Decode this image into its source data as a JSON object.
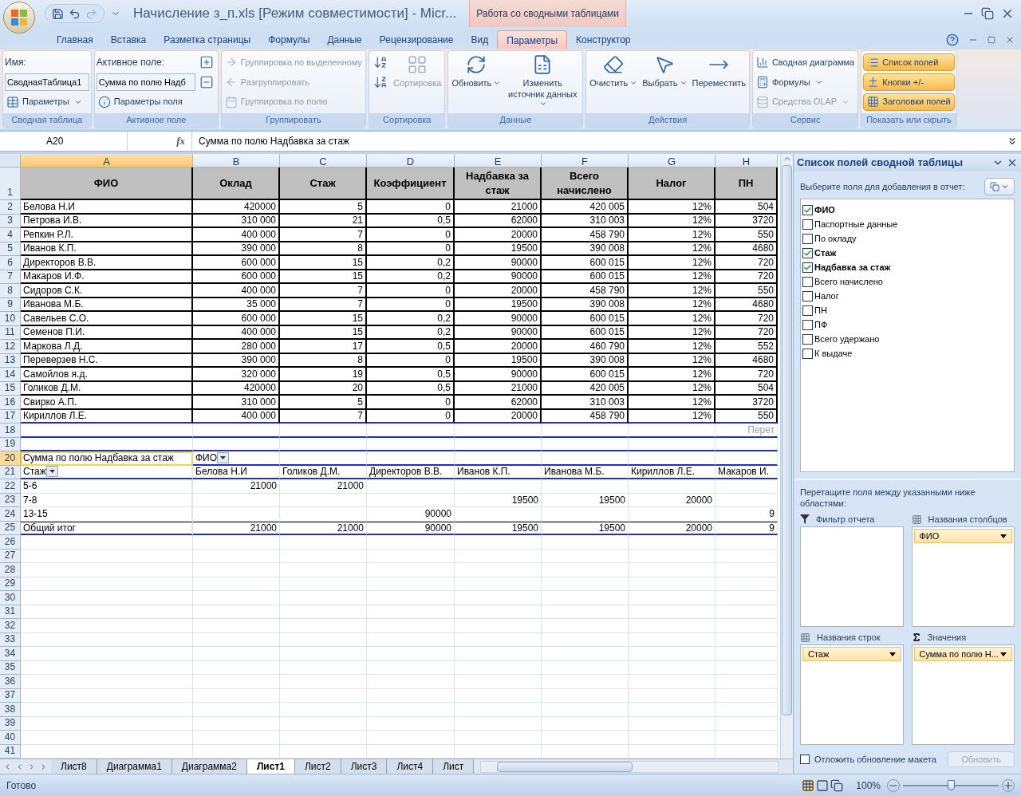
{
  "title_bar": {
    "title": "Начисление з_п.xls  [Режим совместимости] - Micr...",
    "context_tab": "Работа со сводными таблицами"
  },
  "ribbon_tabs": [
    {
      "label": "Главная",
      "selected": false
    },
    {
      "label": "Вставка",
      "selected": false
    },
    {
      "label": "Разметка страницы",
      "selected": false
    },
    {
      "label": "Формулы",
      "selected": false
    },
    {
      "label": "Данные",
      "selected": false
    },
    {
      "label": "Рецензирование",
      "selected": false
    },
    {
      "label": "Вид",
      "selected": false
    },
    {
      "label": "Параметры",
      "selected": true
    },
    {
      "label": "Конструктор",
      "selected": false
    }
  ],
  "ribbon_groups": [
    {
      "label": "Сводная таблица",
      "items": [
        {
          "kind": "caption",
          "label": "Имя:"
        },
        {
          "kind": "field",
          "value": "СводнаяТаблица1"
        },
        {
          "kind": "small",
          "label": "Параметры",
          "dropdown": true,
          "disabled": false
        }
      ]
    },
    {
      "label": "Активное поле",
      "items": [
        {
          "kind": "caption",
          "label": "Активное поле:"
        },
        {
          "kind": "field",
          "value": "Сумма по полю Надб"
        },
        {
          "kind": "small",
          "label": "Параметры поля",
          "disabled": false
        },
        {
          "kind": "icon",
          "disabled": false
        },
        {
          "kind": "icon",
          "disabled": false
        }
      ]
    },
    {
      "label": "Группировать",
      "items": [
        {
          "kind": "small",
          "label": "Группировка по выделенному",
          "disabled": true
        },
        {
          "kind": "small",
          "label": "Разгруппировать",
          "disabled": true
        },
        {
          "kind": "small",
          "label": "Группировка по полю",
          "disabled": true
        }
      ]
    },
    {
      "label": "Сортировка",
      "items": [
        {
          "kind": "icon",
          "disabled": false
        },
        {
          "kind": "icon",
          "disabled": false
        },
        {
          "kind": "large",
          "label": "Сортировка",
          "disabled": true
        }
      ]
    },
    {
      "label": "Данные",
      "items": [
        {
          "kind": "large",
          "label": "Обновить",
          "dropdown": true,
          "disabled": false
        },
        {
          "kind": "large",
          "label": "Изменить источник данных",
          "dropdown": true,
          "disabled": false
        }
      ]
    },
    {
      "label": "Действия",
      "items": [
        {
          "kind": "large",
          "label": "Очистить",
          "dropdown": true,
          "disabled": false
        },
        {
          "kind": "large",
          "label": "Выбрать",
          "dropdown": true,
          "disabled": false
        },
        {
          "kind": "large",
          "label": "Переместить",
          "disabled": false
        }
      ]
    },
    {
      "label": "Сервис",
      "items": [
        {
          "kind": "small",
          "label": "Сводная диаграмма",
          "disabled": false
        },
        {
          "kind": "small",
          "label": "Формулы",
          "dropdown": true,
          "disabled": false
        },
        {
          "kind": "small",
          "label": "Средства OLAP",
          "dropdown": true,
          "disabled": true
        }
      ]
    },
    {
      "label": "Показать или скрыть",
      "items": [
        {
          "kind": "toggle",
          "label": "Список полей",
          "on": true
        },
        {
          "kind": "toggle",
          "label": "Кнопки +/-",
          "on": true
        },
        {
          "kind": "toggle",
          "label": "Заголовки полей",
          "on": true
        }
      ]
    }
  ],
  "formula_bar": {
    "name_box": "A20",
    "function_label": "fx",
    "formula": "Сумма по полю Надбавка за стаж"
  },
  "sheet": {
    "columns": [
      {
        "letter": "A",
        "selected": true
      },
      {
        "letter": "B",
        "selected": false
      },
      {
        "letter": "C",
        "selected": false
      },
      {
        "letter": "D",
        "selected": false
      },
      {
        "letter": "E",
        "selected": false
      },
      {
        "letter": "F",
        "selected": false
      },
      {
        "letter": "G",
        "selected": false
      },
      {
        "letter": "H",
        "selected": false
      }
    ],
    "rows": [
      {
        "number": "1",
        "selected": false,
        "kind": "header",
        "cells": [
          "ФИО",
          "Оклад",
          "Стаж",
          "Коэффициент",
          "Надбавка за стаж",
          "Всего начислено",
          "Налог",
          "ПН"
        ]
      },
      {
        "number": "2",
        "selected": false,
        "kind": "data",
        "cells": [
          "Белова Н.И",
          "420000",
          "5",
          "0",
          "21000",
          "420 005",
          "12%",
          "504"
        ]
      },
      {
        "number": "3",
        "selected": false,
        "kind": "data",
        "cells": [
          "Петрова И.В.",
          "310 000",
          "21",
          "0,5",
          "62000",
          "310 003",
          "12%",
          "3720"
        ]
      },
      {
        "number": "4",
        "selected": false,
        "kind": "data",
        "cells": [
          "Репкин Р.Л.",
          "400 000",
          "7",
          "0",
          "20000",
          "458 790",
          "12%",
          "550"
        ]
      },
      {
        "number": "5",
        "selected": false,
        "kind": "data",
        "cells": [
          "Иванов К.П.",
          "390 000",
          "8",
          "0",
          "19500",
          "390 008",
          "12%",
          "4680"
        ]
      },
      {
        "number": "6",
        "selected": false,
        "kind": "data",
        "cells": [
          "Директоров В.В.",
          "600 000",
          "15",
          "0,2",
          "90000",
          "600 015",
          "12%",
          "720"
        ]
      },
      {
        "number": "7",
        "selected": false,
        "kind": "data",
        "cells": [
          "Макаров И.Ф.",
          "600 000",
          "15",
          "0,2",
          "90000",
          "600 015",
          "12%",
          "720"
        ]
      },
      {
        "number": "8",
        "selected": false,
        "kind": "data",
        "cells": [
          "Сидоров С.К.",
          "400 000",
          "7",
          "0",
          "20000",
          "458 790",
          "12%",
          "550"
        ]
      },
      {
        "number": "9",
        "selected": false,
        "kind": "data",
        "cells": [
          "Иванова М.Б.",
          "35 000",
          "7",
          "0",
          "19500",
          "390 008",
          "12%",
          "4680"
        ]
      },
      {
        "number": "10",
        "selected": false,
        "kind": "data",
        "cells": [
          "Савельев С.О.",
          "600 000",
          "15",
          "0,2",
          "90000",
          "600 015",
          "12%",
          "720"
        ]
      },
      {
        "number": "11",
        "selected": false,
        "kind": "data",
        "cells": [
          "Семенов П.И.",
          "400 000",
          "15",
          "0,2",
          "90000",
          "600 015",
          "12%",
          "720"
        ]
      },
      {
        "number": "12",
        "selected": false,
        "kind": "data",
        "cells": [
          "Маркова Л.Д.",
          "280 000",
          "17",
          "0,5",
          "20000",
          "460 790",
          "12%",
          "552"
        ]
      },
      {
        "number": "13",
        "selected": false,
        "kind": "data",
        "cells": [
          "Переверзев Н.С.",
          "390 000",
          "8",
          "0",
          "19500",
          "390 008",
          "12%",
          "4680"
        ]
      },
      {
        "number": "14",
        "selected": false,
        "kind": "data",
        "cells": [
          "Самойлов я.д.",
          "320 000",
          "19",
          "0,5",
          "90000",
          "600 015",
          "12%",
          "720"
        ]
      },
      {
        "number": "15",
        "selected": false,
        "kind": "data",
        "cells": [
          "Голиков Д.М.",
          "420000",
          "20",
          "0,5",
          "21000",
          "420 005",
          "12%",
          "504"
        ]
      },
      {
        "number": "16",
        "selected": false,
        "kind": "data",
        "cells": [
          "Свирко А.П.",
          "310 000",
          "5",
          "0",
          "62000",
          "310 003",
          "12%",
          "3720"
        ]
      },
      {
        "number": "17",
        "selected": false,
        "kind": "data",
        "cells": [
          "Кириллов Л.Е.",
          "400 000",
          "7",
          "0",
          "20000",
          "458 790",
          "12%",
          "550"
        ]
      },
      {
        "number": "18",
        "selected": false,
        "kind": "note",
        "cells": [
          null,
          null,
          null,
          null,
          null,
          null,
          null,
          "Перет"
        ]
      },
      {
        "number": "19",
        "selected": false,
        "kind": "blank"
      },
      {
        "number": "20",
        "selected": true,
        "kind": "pivot-filter",
        "cells": [
          "Сумма по полю Надбавка за стаж",
          "ФИО"
        ]
      },
      {
        "number": "21",
        "selected": false,
        "kind": "pivot-header",
        "cells": [
          "Стаж",
          "Белова Н.И",
          "Голиков Д.М.",
          "Директоров В.В.",
          "Иванов К.П.",
          "Иванова М.Б.",
          "Кириллов Л.Е.",
          "Макаров И."
        ]
      },
      {
        "number": "22",
        "selected": false,
        "kind": "pivot-data",
        "cells": [
          "5-6",
          "21000",
          "21000",
          null,
          null,
          null,
          null,
          null
        ]
      },
      {
        "number": "23",
        "selected": false,
        "kind": "pivot-data",
        "cells": [
          "7-8",
          null,
          null,
          null,
          "19500",
          "19500",
          "20000",
          null
        ]
      },
      {
        "number": "24",
        "selected": false,
        "kind": "pivot-data",
        "cells": [
          "13-15",
          null,
          null,
          "90000",
          null,
          null,
          null,
          "9"
        ]
      },
      {
        "number": "25",
        "selected": false,
        "kind": "pivot-total",
        "cells": [
          "Общий итог",
          "21000",
          "21000",
          "90000",
          "19500",
          "19500",
          "20000",
          "9"
        ]
      },
      {
        "number": "26",
        "selected": false,
        "kind": "blank"
      },
      {
        "number": "27",
        "selected": false,
        "kind": "blank"
      },
      {
        "number": "28",
        "selected": false,
        "kind": "blank"
      },
      {
        "number": "29",
        "selected": false,
        "kind": "blank"
      },
      {
        "number": "30",
        "selected": false,
        "kind": "blank"
      },
      {
        "number": "31",
        "selected": false,
        "kind": "blank"
      },
      {
        "number": "32",
        "selected": false,
        "kind": "blank"
      },
      {
        "number": "33",
        "selected": false,
        "kind": "blank"
      },
      {
        "number": "34",
        "selected": false,
        "kind": "blank"
      },
      {
        "number": "35",
        "selected": false,
        "kind": "blank"
      },
      {
        "number": "36",
        "selected": false,
        "kind": "blank"
      },
      {
        "number": "37",
        "selected": false,
        "kind": "blank"
      },
      {
        "number": "38",
        "selected": false,
        "kind": "blank"
      },
      {
        "number": "39",
        "selected": false,
        "kind": "blank"
      },
      {
        "number": "40",
        "selected": false,
        "kind": "blank"
      },
      {
        "number": "41",
        "selected": false,
        "kind": "blank"
      }
    ]
  },
  "sheet_tabs": [
    {
      "label": "Лист8",
      "selected": false
    },
    {
      "label": "Диаграмма1",
      "selected": false
    },
    {
      "label": "Диаграмма2",
      "selected": false
    },
    {
      "label": "Лист1",
      "selected": true
    },
    {
      "label": "Лист2",
      "selected": false
    },
    {
      "label": "Лист3",
      "selected": false
    },
    {
      "label": "Лист4",
      "selected": false
    },
    {
      "label": "Лист",
      "selected": false
    }
  ],
  "field_list": {
    "title": "Список полей сводной таблицы",
    "prompt": "Выберите поля для добавления в отчет:",
    "fields": [
      {
        "label": "ФИО",
        "checked": true
      },
      {
        "label": "Паспортные данные",
        "checked": false
      },
      {
        "label": "По окладу",
        "checked": false
      },
      {
        "label": "Стаж",
        "checked": true
      },
      {
        "label": "Надбавка за стаж",
        "checked": true
      },
      {
        "label": "Всего начислено",
        "checked": false
      },
      {
        "label": "Налог",
        "checked": false
      },
      {
        "label": "ПН",
        "checked": false
      },
      {
        "label": "ПФ",
        "checked": false
      },
      {
        "label": "Всего удержано",
        "checked": false
      },
      {
        "label": "К выдаче",
        "checked": false
      }
    ],
    "instruction": "Перетащите поля между указанными ниже областями:",
    "areas": [
      {
        "kind": "filter",
        "label": "Фильтр отчета"
      },
      {
        "kind": "columns",
        "label": "Названия столбцов",
        "items": [
          "ФИО"
        ]
      },
      {
        "kind": "rows",
        "label": "Названия строк",
        "items": [
          "Стаж"
        ]
      },
      {
        "kind": "values",
        "label": "Значения",
        "items": [
          "Сумма по полю Н..."
        ]
      }
    ],
    "defer": {
      "label": "Отложить обновление макета",
      "checked": false
    },
    "update_button": {
      "label": "Обновить",
      "disabled": true
    }
  },
  "status_bar": {
    "status": "Готово",
    "zoom_label": "100%",
    "zoom": {
      "level": 0.5
    }
  }
}
